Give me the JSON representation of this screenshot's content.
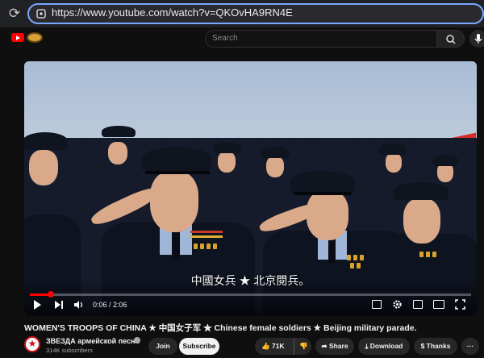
{
  "browser": {
    "url": "https://www.youtube.com/watch?v=QKOvHA9RN4E",
    "reload_icon": "reload-icon",
    "lock_icon": "site-info-icon"
  },
  "header": {
    "logo_icon": "youtube-logo-icon",
    "search_placeholder": "Search",
    "search_icon": "search-icon",
    "mic_icon": "microphone-icon"
  },
  "player": {
    "subtitle": "中國女兵 ★ 北京閱兵。",
    "time_current": "0:06",
    "time_total": "2:06",
    "progress": 0.048,
    "time_display": "0:06 / 2:06"
  },
  "video": {
    "title": "WOMEN'S TROOPS OF CHINA ★ 中国女子军 ★ Chinese female soldiers ★ Beijing military parade.",
    "channel": "ЗВЕЗДА армейской песни",
    "subscribers": "314K subscribers",
    "join_label": "Join",
    "subscribe_label": "Subscribe",
    "likes": "71K",
    "share_label": "Share",
    "download_label": "Download",
    "thanks_label": "Thanks",
    "more_label": "···"
  },
  "colors": {
    "accent": "#ff0000",
    "background": "#0f0f0f",
    "url_focus": "#7aa7ff"
  }
}
